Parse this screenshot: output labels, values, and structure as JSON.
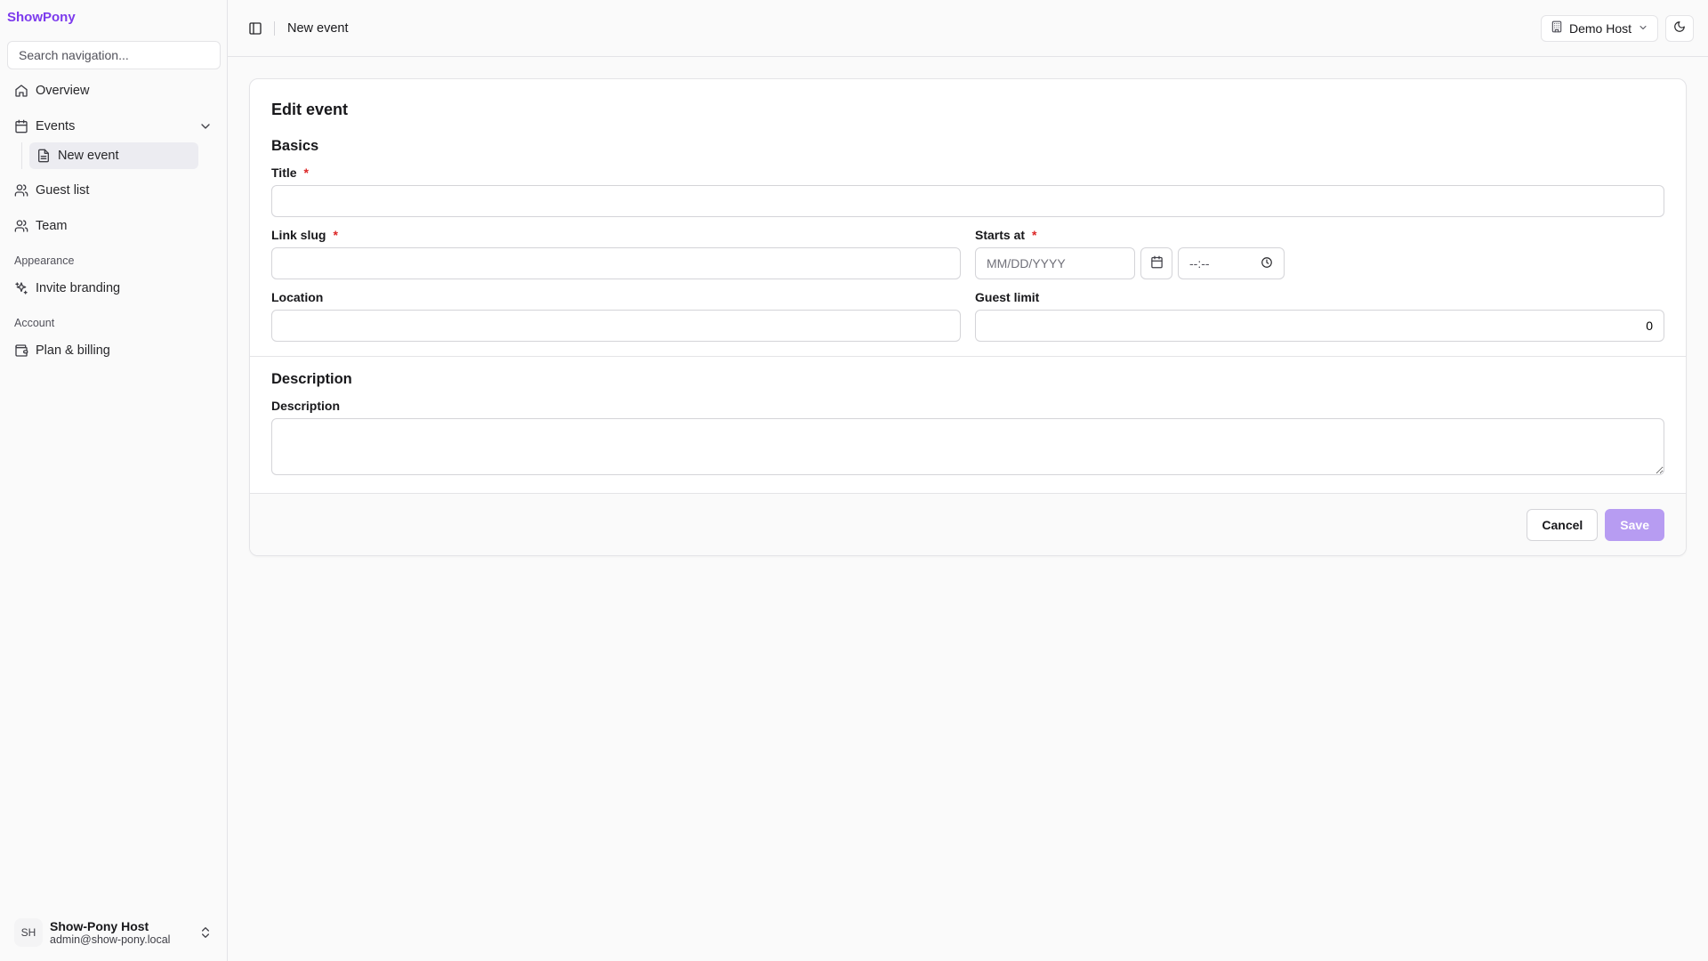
{
  "app": {
    "brand": "ShowPony"
  },
  "sidebar": {
    "search_placeholder": "Search navigation...",
    "items": [
      {
        "label": "Overview",
        "icon": "home-icon"
      },
      {
        "label": "Events",
        "icon": "calendar-icon",
        "expanded": true,
        "children": [
          {
            "label": "New event",
            "icon": "file-icon",
            "active": true
          }
        ]
      },
      {
        "label": "Guest list",
        "icon": "users-icon"
      },
      {
        "label": "Team",
        "icon": "users-icon"
      }
    ],
    "sections": [
      {
        "title": "Appearance",
        "items": [
          {
            "label": "Invite branding",
            "icon": "sparkles-icon"
          }
        ]
      },
      {
        "title": "Account",
        "items": [
          {
            "label": "Plan & billing",
            "icon": "wallet-icon"
          }
        ]
      }
    ],
    "user": {
      "initials": "SH",
      "name": "Show-Pony Host",
      "email": "admin@show-pony.local"
    }
  },
  "header": {
    "breadcrumb": "New event",
    "host_selector": "Demo Host",
    "theme_icon": "moon-icon"
  },
  "form": {
    "title": "Edit event",
    "basics": {
      "heading": "Basics",
      "title_label": "Title",
      "title_value": "",
      "slug_label": "Link slug",
      "slug_value": "",
      "starts_label": "Starts at",
      "date_placeholder": "MM/DD/YYYY",
      "time_placeholder": "--:--",
      "location_label": "Location",
      "location_value": "",
      "guest_limit_label": "Guest limit",
      "guest_limit_value": "0",
      "required_mark": "*"
    },
    "description": {
      "heading": "Description",
      "label": "Description",
      "value": ""
    },
    "actions": {
      "cancel": "Cancel",
      "save": "Save"
    }
  },
  "colors": {
    "brand": "#7c3aed",
    "save_disabled": "#b79cf2",
    "required": "#dc2626"
  }
}
